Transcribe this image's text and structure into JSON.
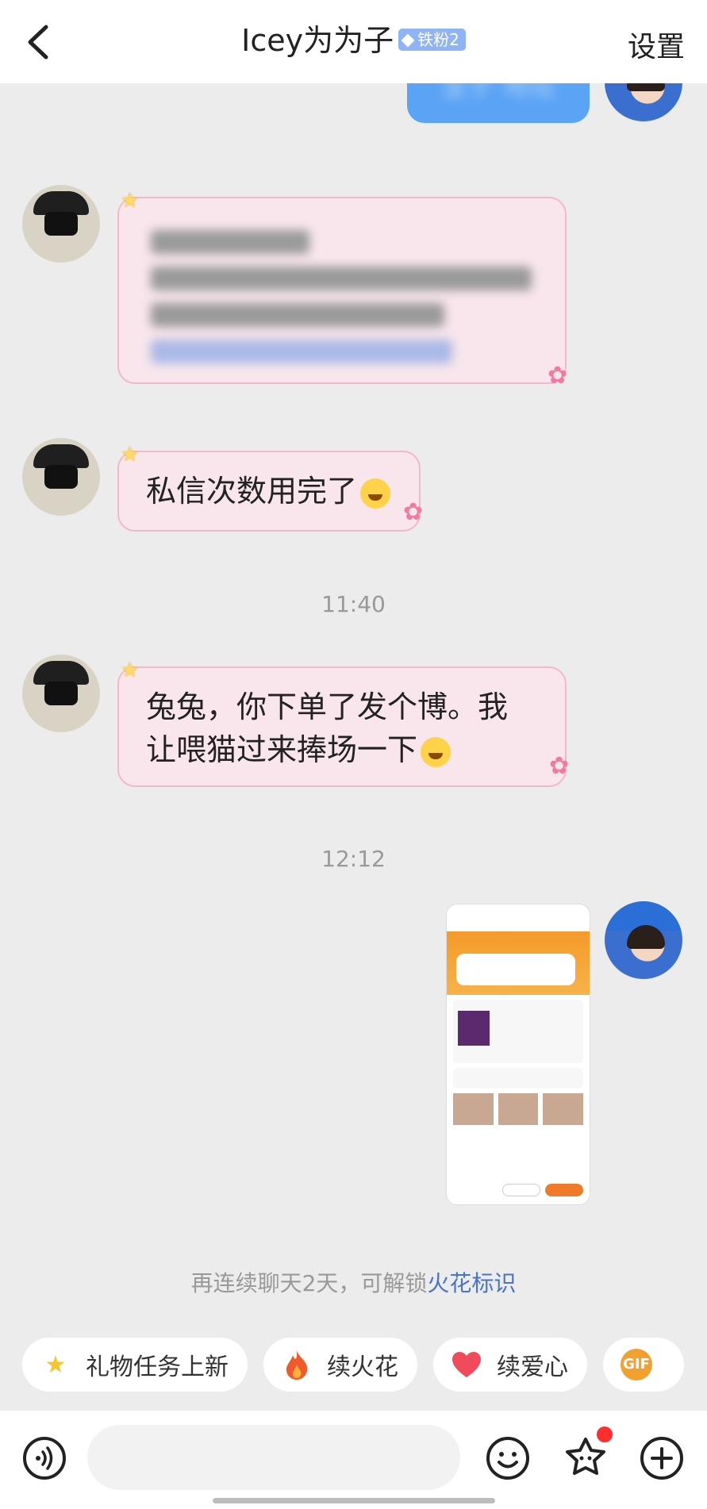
{
  "header": {
    "back_label": "返回",
    "title": "Icey为为子",
    "fan_badge": "铁粉2",
    "settings_label": "设置"
  },
  "messages": {
    "top_partial_text": "宝子 地址",
    "msg2_text": "私信次数用完了",
    "time1": "11:40",
    "msg3_line1": "兔兔，你下单了发个博。我",
    "msg3_line2": "让喂猫过来捧场一下",
    "time2": "12:12"
  },
  "streak": {
    "prefix": "再连续聊天2天，可解锁",
    "link": "火花标识"
  },
  "chips": {
    "gift_task": "礼物任务上新",
    "fire": "续火花",
    "love": "续爱心",
    "gif": "GIF"
  },
  "input": {
    "placeholder": ""
  },
  "colors": {
    "bubble_bg": "#f8e6ec",
    "bubble_border": "#f2b8c8",
    "link": "#4a72c6",
    "badge": "#8fb4f5",
    "my_bubble": "#5ba3f5"
  },
  "icons": {
    "back": "chevron-left-icon",
    "voice": "voice-icon",
    "emoji": "emoji-icon",
    "sticker": "sticker-icon",
    "plus": "plus-icon"
  }
}
